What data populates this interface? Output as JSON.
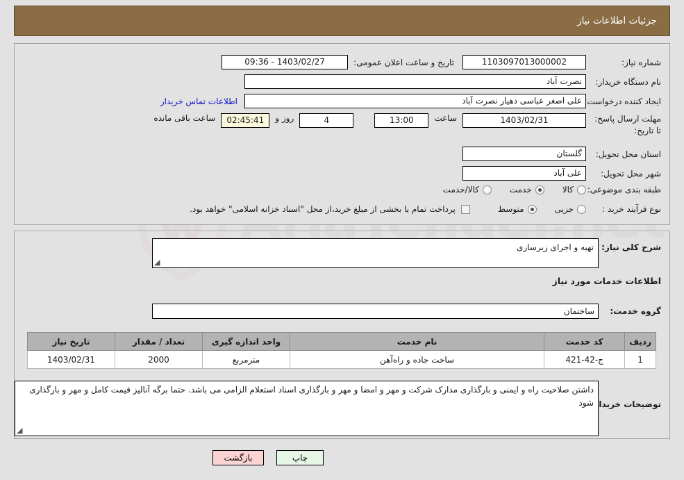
{
  "header": {
    "title": "جزئیات اطلاعات نیاز"
  },
  "top": {
    "need_number_label": "شماره نیاز:",
    "need_number_value": "1103097013000002",
    "announce_label": "تاریخ و ساعت اعلان عمومی:",
    "announce_value": "1403/02/27 - 09:36",
    "buyer_org_label": "نام دستگاه خریدار:",
    "buyer_org_value": "نصرت آباد",
    "creator_label": "ایجاد کننده درخواست:",
    "creator_value": "علی اصغر عباسی دهیار نصرت آباد",
    "contact_link": "اطلاعات تماس خریدار",
    "deadline_label": "مهلت ارسال پاسخ: تا تاریخ:",
    "deadline_date": "1403/02/31",
    "hour_label": "ساعت",
    "deadline_time": "13:00",
    "days_value": "4",
    "days_label": "روز و",
    "countdown_value": "02:45:41",
    "countdown_label": "ساعت باقی مانده",
    "province_label": "استان محل تحویل:",
    "province_value": "گلستان",
    "city_label": "شهر محل تحویل:",
    "city_value": "علی آباد",
    "category_label": "طبقه بندی موضوعی:",
    "category_options": [
      {
        "label": "کالا",
        "selected": false
      },
      {
        "label": "خدمت",
        "selected": true
      },
      {
        "label": "کالا/خدمت",
        "selected": false
      }
    ],
    "process_label": "نوع فرآیند خرید :",
    "process_options": [
      {
        "label": "جزیی",
        "selected": false
      },
      {
        "label": "متوسط",
        "selected": true
      }
    ],
    "treasury_checkbox_label": "پرداخت تمام یا بخشی از مبلغ خرید،از محل \"اسناد خزانه اسلامی\" خواهد بود.",
    "treasury_checked": false
  },
  "middle": {
    "general_desc_label": "شرح کلی نیاز:",
    "general_desc_value": "تهیه و اجرای زیرسازی",
    "services_heading": "اطلاعات خدمات مورد نیاز",
    "service_group_label": "گروه خدمت:",
    "service_group_value": "ساختمان",
    "buyer_notes_label": "توضیحات خریدار:",
    "buyer_notes_value": "داشتن صلاحیت راه و ایمنی و بارگذاری مدارک شرکت و مهر و امضا و مهر و بارگذاری اسناد استعلام الزامی می باشد. حتما برگه آنالیز قیمت کامل و مهر و بارگذاری شود"
  },
  "table": {
    "columns": [
      "ردیف",
      "کد خدمت",
      "نام خدمت",
      "واحد اندازه گیری",
      "تعداد / مقدار",
      "تاریخ نیاز"
    ],
    "rows": [
      {
        "row_no": "1",
        "service_code": "ج-42-421",
        "service_name": "ساخت جاده و راه‌آهن",
        "unit": "مترمربع",
        "quantity": "2000",
        "need_date": "1403/02/31"
      }
    ]
  },
  "footer": {
    "print_label": "چاپ",
    "back_label": "بازگشت"
  },
  "watermark": {
    "text": "AriaTender.net"
  },
  "colors": {
    "header_bg": "#8a6d45",
    "page_bg": "#e2e2e2",
    "link": "#1414cc",
    "timer_bg": "#fbf8dd",
    "print_btn_bg": "#e6f6e6",
    "back_btn_bg": "#fbd3d3",
    "table_header_bg": "#b3b3b3"
  }
}
